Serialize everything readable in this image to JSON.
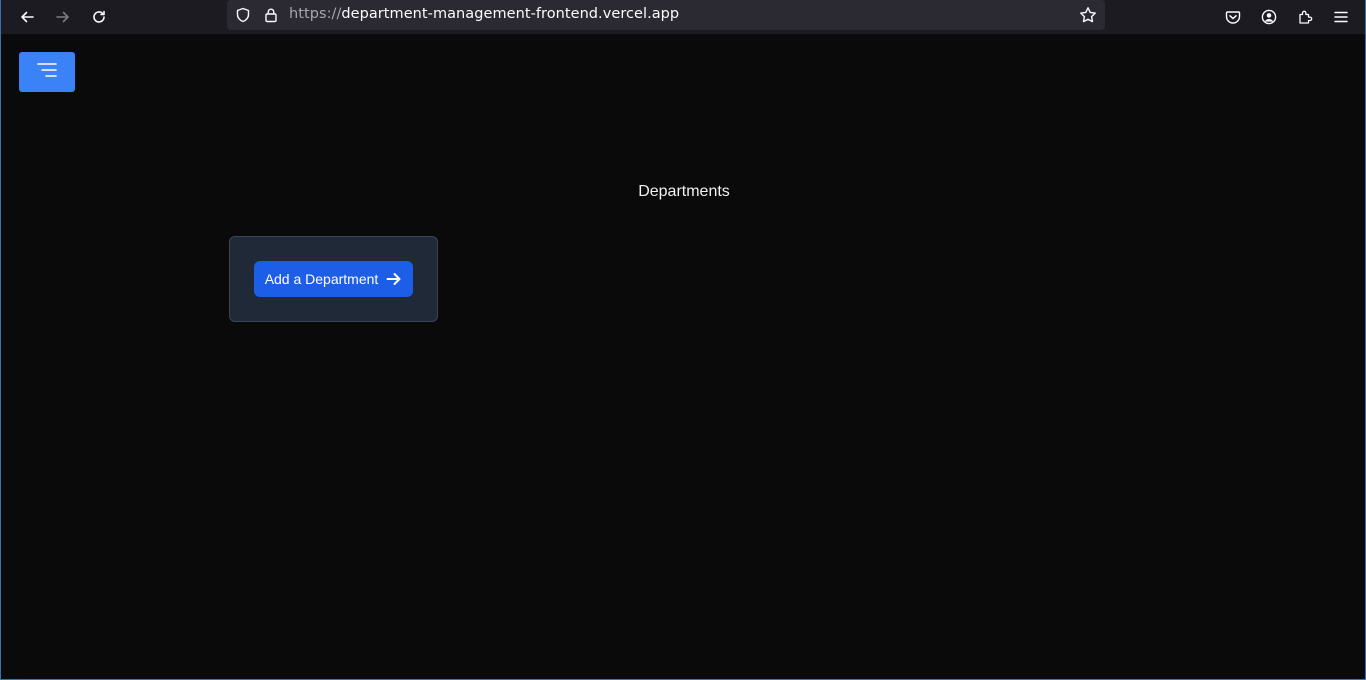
{
  "browser": {
    "url_scheme": "https://",
    "url_host": "department-management-frontend.vercel.app",
    "icons": {
      "back": "back-arrow-icon",
      "forward": "forward-arrow-icon",
      "reload": "reload-icon",
      "shield": "tracking-protection-shield-icon",
      "lock": "lock-icon",
      "bookmark": "star-icon",
      "pocket": "pocket-icon",
      "account": "account-icon",
      "extensions": "extensions-icon",
      "menu": "hamburger-menu-icon"
    }
  },
  "page": {
    "title": "Departments",
    "add_button_label": "Add a Department",
    "menu_toggle_icon": "menu-lines-icon",
    "accent_color": "#3b82f6",
    "button_color": "#1d5ee8",
    "card_color": "#1f2937"
  }
}
